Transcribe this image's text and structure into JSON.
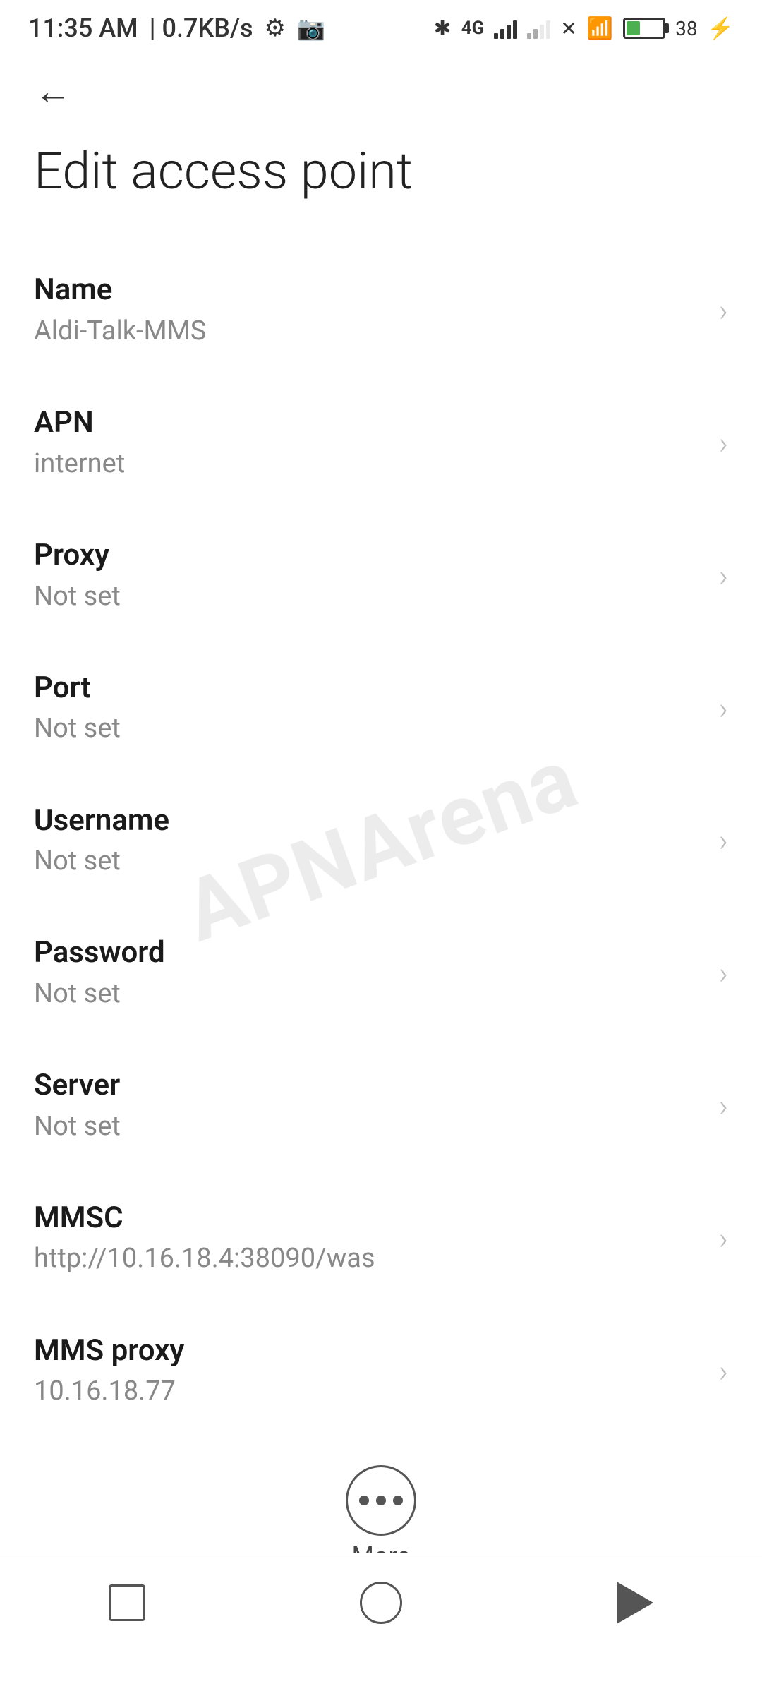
{
  "statusBar": {
    "time": "11:35 AM",
    "speed": "0.7KB/s"
  },
  "toolbar": {
    "backLabel": "←"
  },
  "page": {
    "title": "Edit access point"
  },
  "settings": [
    {
      "label": "Name",
      "value": "Aldi-Talk-MMS"
    },
    {
      "label": "APN",
      "value": "internet"
    },
    {
      "label": "Proxy",
      "value": "Not set"
    },
    {
      "label": "Port",
      "value": "Not set"
    },
    {
      "label": "Username",
      "value": "Not set"
    },
    {
      "label": "Password",
      "value": "Not set"
    },
    {
      "label": "Server",
      "value": "Not set"
    },
    {
      "label": "MMSC",
      "value": "http://10.16.18.4:38090/was"
    },
    {
      "label": "MMS proxy",
      "value": "10.16.18.77"
    }
  ],
  "more": {
    "label": "More"
  },
  "watermark": {
    "text": "APNArena"
  }
}
